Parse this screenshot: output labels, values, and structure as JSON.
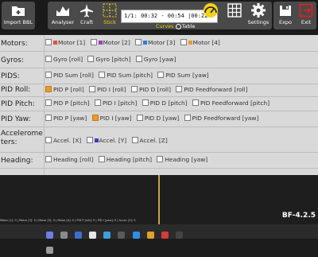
{
  "toolbar": {
    "import_label": "Import BBL",
    "analyser_label": "Analyser",
    "craft_label": "Craft",
    "stick_label": "Stick",
    "time_range": "1/1: 00:32 - 00:54 |00:22",
    "curves_label": "Curves",
    "table_label": "Table",
    "settings_label": "Settings",
    "expo_label": "Expo",
    "exit_label": "Exit"
  },
  "rows": [
    {
      "label": "Motors:",
      "items": [
        {
          "text": "Motor [1]",
          "color": "#e0533a",
          "checked": false
        },
        {
          "text": "Motor [2]",
          "color": "#a23fc2",
          "checked": false
        },
        {
          "text": "Motor [3]",
          "color": "#2f7fd6",
          "checked": false
        },
        {
          "text": "Motor [4]",
          "color": "#e89a2b",
          "checked": false
        }
      ]
    },
    {
      "label": "Gyros:",
      "items": [
        {
          "text": "Gyro [roll]",
          "checked": false
        },
        {
          "text": "Gyro [pitch]",
          "checked": false
        },
        {
          "text": "Gyro [yaw]",
          "checked": false
        }
      ]
    },
    {
      "label": "PIDS:",
      "items": [
        {
          "text": "PID Sum [roll]",
          "checked": false
        },
        {
          "text": "PID Sum [pitch]",
          "checked": false
        },
        {
          "text": "PID Sum [yaw]",
          "checked": false
        }
      ]
    },
    {
      "label": "PID Roll:",
      "items": [
        {
          "text": "PID P [roll]",
          "checked": true
        },
        {
          "text": "PID I [roll]",
          "checked": false
        },
        {
          "text": "PID D [roll]",
          "checked": false
        },
        {
          "text": "PID Feedforward [roll]",
          "checked": false
        }
      ]
    },
    {
      "label": "PID Pitch:",
      "items": [
        {
          "text": "PID P [pitch]",
          "checked": false
        },
        {
          "text": "PID I [pitch]",
          "checked": false
        },
        {
          "text": "PID D [pitch]",
          "checked": false
        },
        {
          "text": "PID Feedforward [pitch]",
          "checked": false
        }
      ]
    },
    {
      "label": "PID Yaw:",
      "items": [
        {
          "text": "PID P [yaw]",
          "checked": false
        },
        {
          "text": "PID I [yaw]",
          "checked": true
        },
        {
          "text": "PID D [yaw]",
          "checked": false
        },
        {
          "text": "PID Feedforward [yaw]",
          "checked": false
        }
      ]
    },
    {
      "label": "Accelerome ters:",
      "items": [
        {
          "text": "Accel. [X]",
          "checked": false
        },
        {
          "text": "Accel. [Y]",
          "color": "#3a3fc2",
          "checked": false
        },
        {
          "text": "Accel. [Z]",
          "checked": false
        }
      ]
    },
    {
      "label": "Heading:",
      "items": [
        {
          "text": "Heading [roll]",
          "checked": false
        },
        {
          "text": "Heading [pitch]",
          "checked": false
        },
        {
          "text": "Heading [yaw]",
          "checked": false
        }
      ]
    }
  ],
  "graph": {
    "version": "BF-4.2.5",
    "legend": "Motor [1]: 0 | Motor [2]: 0 | Motor [3]: 0 | Motor [4]: 0 | PID P [roll]: 0 | PID I [yaw]: 0 | Accel. [Y]: 0"
  },
  "colors": {
    "accent": "#f2d21a",
    "exit": "#e0201e",
    "checked": "#e89a2b"
  }
}
